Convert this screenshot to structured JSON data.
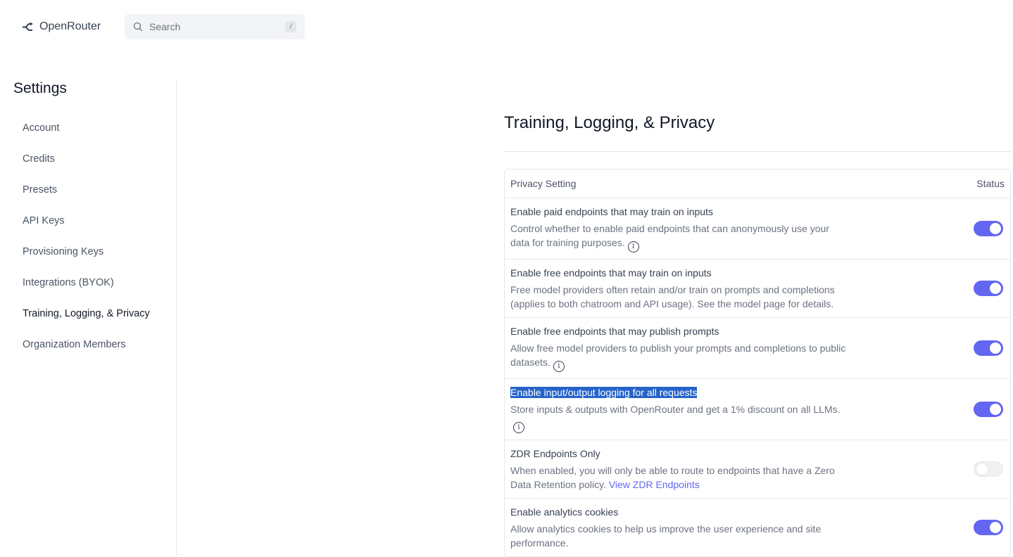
{
  "header": {
    "app_name": "OpenRouter",
    "search_placeholder": "Search",
    "search_shortcut": "/"
  },
  "sidebar": {
    "title": "Settings",
    "items": [
      {
        "label": "Account",
        "active": false
      },
      {
        "label": "Credits",
        "active": false
      },
      {
        "label": "Presets",
        "active": false
      },
      {
        "label": "API Keys",
        "active": false
      },
      {
        "label": "Provisioning Keys",
        "active": false
      },
      {
        "label": "Integrations (BYOK)",
        "active": false
      },
      {
        "label": "Training, Logging, & Privacy",
        "active": true
      },
      {
        "label": "Organization Members",
        "active": false
      }
    ]
  },
  "main": {
    "title": "Training, Logging, & Privacy",
    "table": {
      "col_setting": "Privacy Setting",
      "col_status": "Status",
      "rows": [
        {
          "title": "Enable paid endpoints that may train on inputs",
          "desc": "Control whether to enable paid endpoints that can anonymously use your data for training purposes.",
          "enabled": true
        },
        {
          "title": "Enable free endpoints that may train on inputs",
          "desc": "Free model providers often retain and/or train on prompts and completions (applies to both chatroom and API usage). See the model page for details.",
          "enabled": true
        },
        {
          "title": "Enable free endpoints that may publish prompts",
          "desc": "Allow free model providers to publish your prompts and completions to public datasets.",
          "enabled": true
        },
        {
          "title": "Enable input/output logging for all requests",
          "desc": "Store inputs & outputs with OpenRouter and get a 1% discount on all LLMs.",
          "enabled": true
        },
        {
          "title": "ZDR Endpoints Only",
          "desc": "When enabled, you will only be able to route to endpoints that have a Zero Data Retention policy.",
          "link": "View ZDR Endpoints",
          "enabled": false
        },
        {
          "title": "Enable analytics cookies",
          "desc": "Allow analytics cookies to help us improve the user experience and site performance.",
          "enabled": true
        }
      ]
    }
  },
  "colors": {
    "accent": "#6366f1",
    "selection": "#2563c9"
  }
}
